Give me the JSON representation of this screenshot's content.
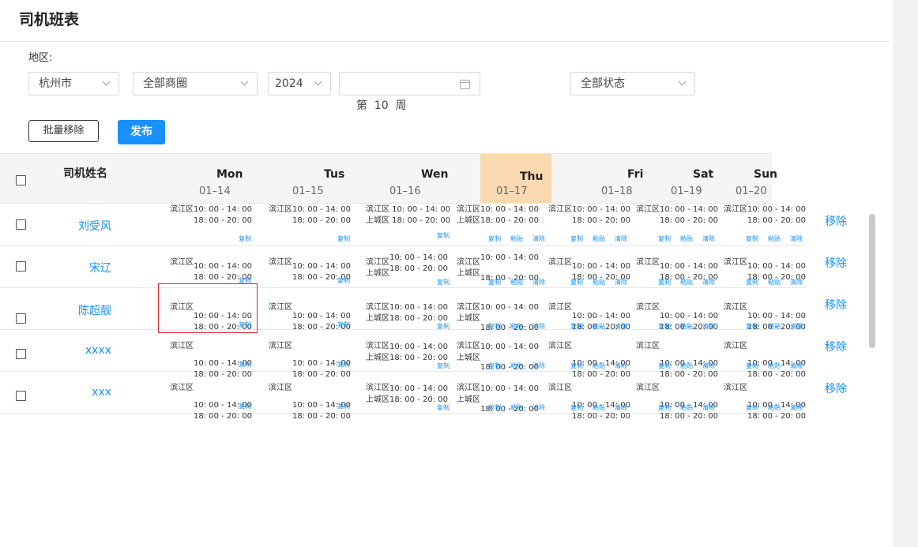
{
  "page": {
    "title": "司机班表"
  },
  "filters": {
    "region_label": "地区:",
    "city": "杭州市",
    "business_area": "全部商圈",
    "year": "2024",
    "week": "第  10  周",
    "status": "全部状态"
  },
  "toolbar": {
    "batch_remove": "批量移除",
    "publish": "发布"
  },
  "table": {
    "name_header": "司机姓名",
    "days": [
      {
        "day": "Mon",
        "date": "01–14"
      },
      {
        "day": "Tus",
        "date": "01–15"
      },
      {
        "day": "Wen",
        "date": "01–16"
      },
      {
        "day": "Thu",
        "date": "01–17",
        "highlight": true
      },
      {
        "day": "Fri",
        "date": "01–18"
      },
      {
        "day": "Sat",
        "date": "01–19"
      },
      {
        "day": "Sun",
        "date": "01–20"
      }
    ],
    "drivers": [
      "刘受风",
      "宋辽",
      "陈超靓",
      "xxxx",
      "xxx"
    ],
    "remove_label": "移除",
    "cell": {
      "district_binjiang": "滨江区",
      "district_shangcheng": "上城区",
      "slot_1": "10: 00 - 14: 00",
      "slot_2": "18: 00 - 20: 00",
      "slot_1_joined": "滨江区10: 00 - 14: 00",
      "slot_1_wen": "滨江区 10: 00 - 14: 00",
      "slot_2_wen": "上城区 18: 00 - 20: 00",
      "copy": "复制",
      "paste": "粘贴",
      "clear": "清除"
    }
  }
}
